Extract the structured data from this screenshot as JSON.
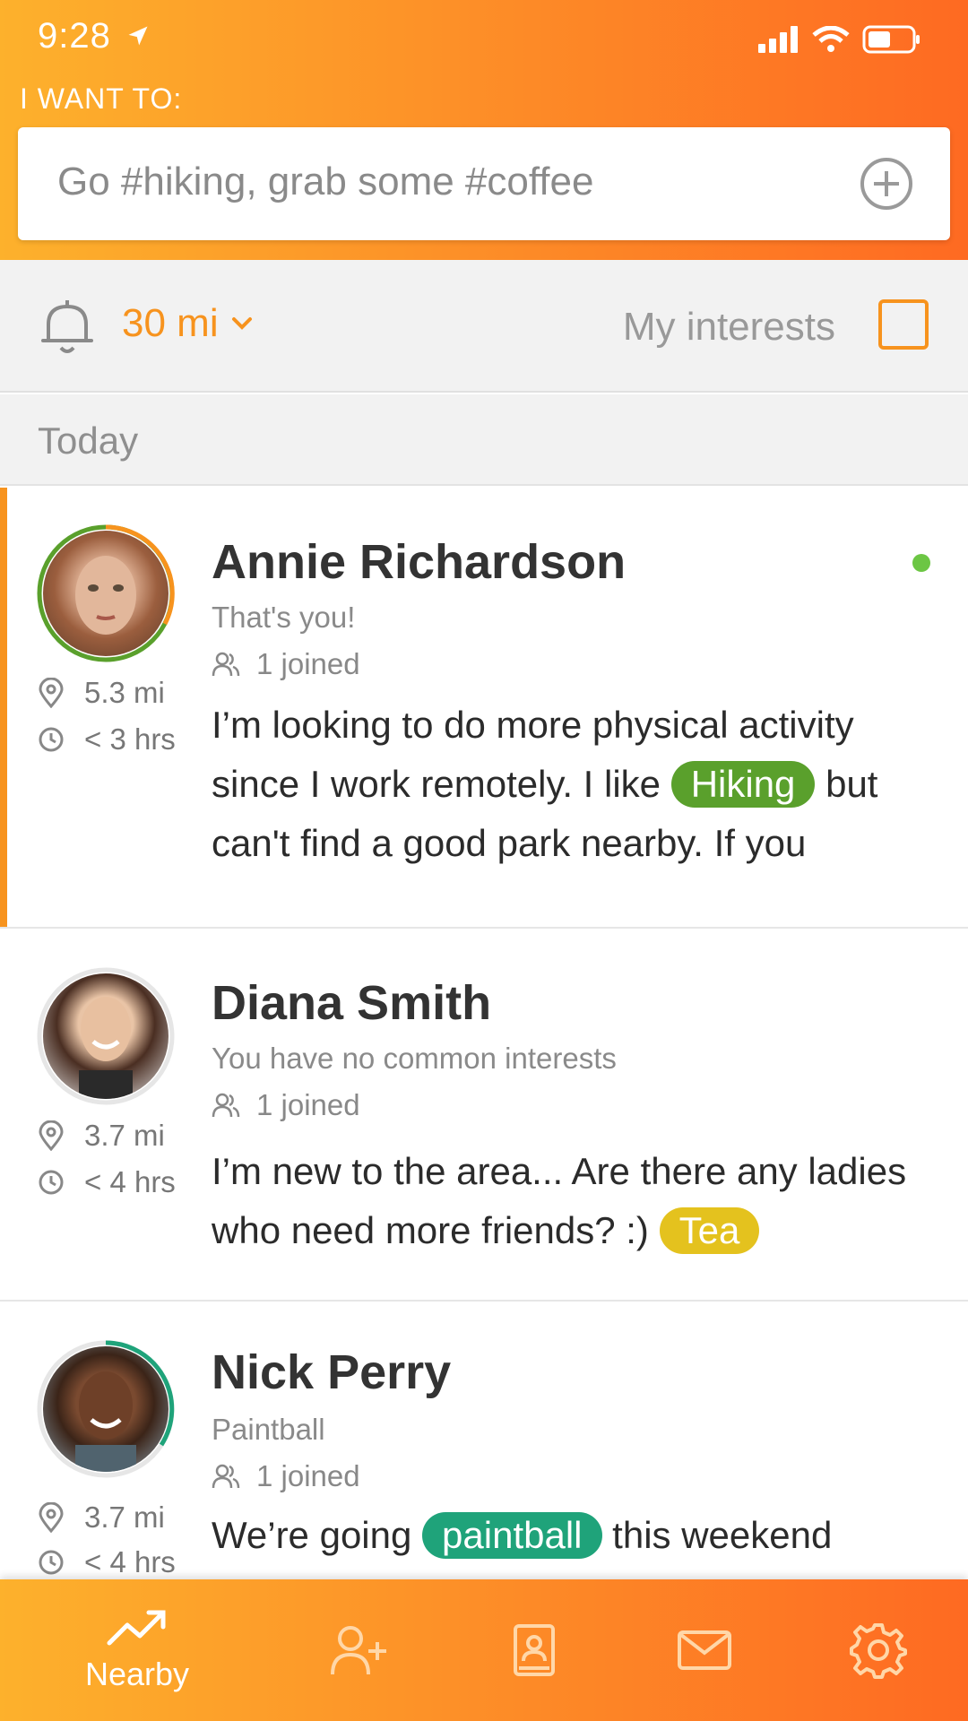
{
  "status_bar": {
    "time": "9:28"
  },
  "header": {
    "want_label": "I WANT TO:",
    "search_placeholder": "Go #hiking, grab some #coffee"
  },
  "filter": {
    "distance": "30 mi",
    "interests_label": "My interests",
    "interests_checked": false
  },
  "section": {
    "today": "Today"
  },
  "posts": [
    {
      "name": "Annie Richardson",
      "subtitle": "That's you!",
      "joined": "1 joined",
      "distance": "5.3 mi",
      "time": "< 3 hrs",
      "online": true,
      "text_before": "I’m looking to do more physical activity since I work remotely. I like",
      "tag": "Hiking",
      "tag_color": "#5aa02c",
      "text_after": "but can't find a good park nearby. If you"
    },
    {
      "name": "Diana Smith",
      "subtitle": "You have no common interests",
      "joined": "1 joined",
      "distance": "3.7 mi",
      "time": "< 4 hrs",
      "text_before": "I’m new to the area... Are there any ladies who need more friends? :)",
      "tag": "Tea",
      "tag_color": "#e4c21e",
      "text_after": ""
    },
    {
      "name": "Nick Perry",
      "subtitle": "Paintball",
      "joined": "1 joined",
      "distance": "3.7 mi",
      "time": "< 4 hrs",
      "text_before": "We’re going",
      "tag": "paintball",
      "tag_color": "#1fa37a",
      "text_after": "this weekend"
    }
  ],
  "tabbar": {
    "nearby_label": "Nearby",
    "icons": [
      "trending-up-icon",
      "add-user-icon",
      "contacts-book-icon",
      "mail-icon",
      "gear-icon"
    ]
  },
  "colors": {
    "accent": "#f7931e",
    "online": "#6cc644"
  }
}
